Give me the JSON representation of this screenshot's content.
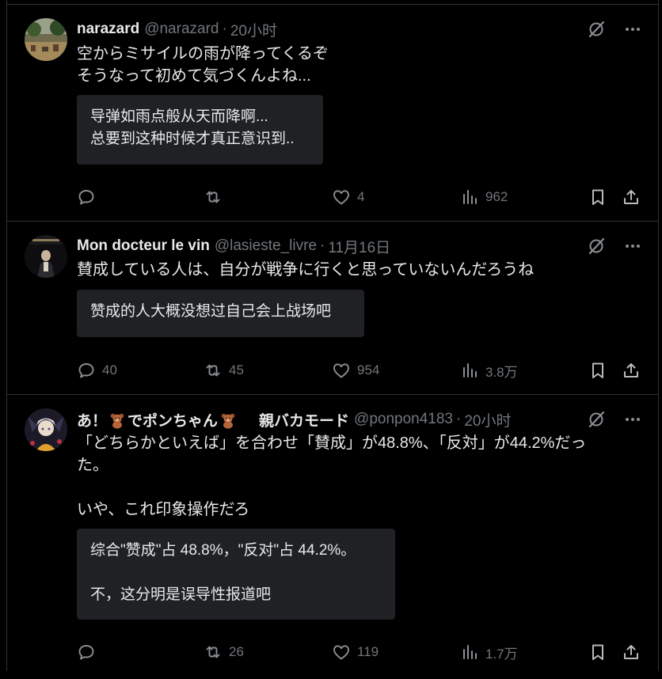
{
  "tweets": [
    {
      "name": "narazard",
      "handle": "@narazard",
      "time": "20小时",
      "lines": [
        "空からミサイルの雨が降ってくるぞ",
        "そうなって初めて気づくんよね..."
      ],
      "translation": [
        "导弹如雨点般从天而降啊...",
        "总要到这种时候才真正意识到.."
      ],
      "stats": {
        "reply": "",
        "retweet": "",
        "like": "4",
        "views": "962"
      }
    },
    {
      "name": "Mon docteur le vin",
      "handle": "@lasieste_livre",
      "time": "11月16日",
      "lines": [
        "賛成している人は、自分が戦争に行くと思っていないんだろうね"
      ],
      "translation": [
        "赞成的人大概没想过自己会上战场吧"
      ],
      "stats": {
        "reply": "40",
        "retweet": "45",
        "like": "954",
        "views": "3.8万"
      }
    },
    {
      "name_part1": "あ！",
      "name_part2": "でポンちゃん",
      "name_part3": "親バカモード",
      "handle": "@ponpon4183",
      "time": "20小时",
      "lines": [
        "「どちらかといえば」を合わせ「賛成」が48.8%、「反対」が44.2%だっ",
        "た。",
        "",
        "いや、これ印象操作だろ"
      ],
      "translation": [
        "综合\"赞成\"占 48.8%，\"反对\"占 44.2%。",
        "",
        "不，这分明是误导性报道吧"
      ],
      "stats": {
        "reply": "",
        "retweet": "26",
        "like": "119",
        "views": "1.7万"
      }
    }
  ],
  "icons": {
    "grok": "grok-icon",
    "more": "more-icon",
    "reply": "reply-icon",
    "retweet": "retweet-icon",
    "like": "like-icon",
    "views": "views-icon",
    "bookmark": "bookmark-icon",
    "share": "share-icon",
    "bear": "teddy-bear-emoji"
  },
  "colors": {
    "background": "#000000",
    "text": "#e7e9ea",
    "muted": "#71767b",
    "border": "#2f3336",
    "translation_bg": "#202124"
  }
}
